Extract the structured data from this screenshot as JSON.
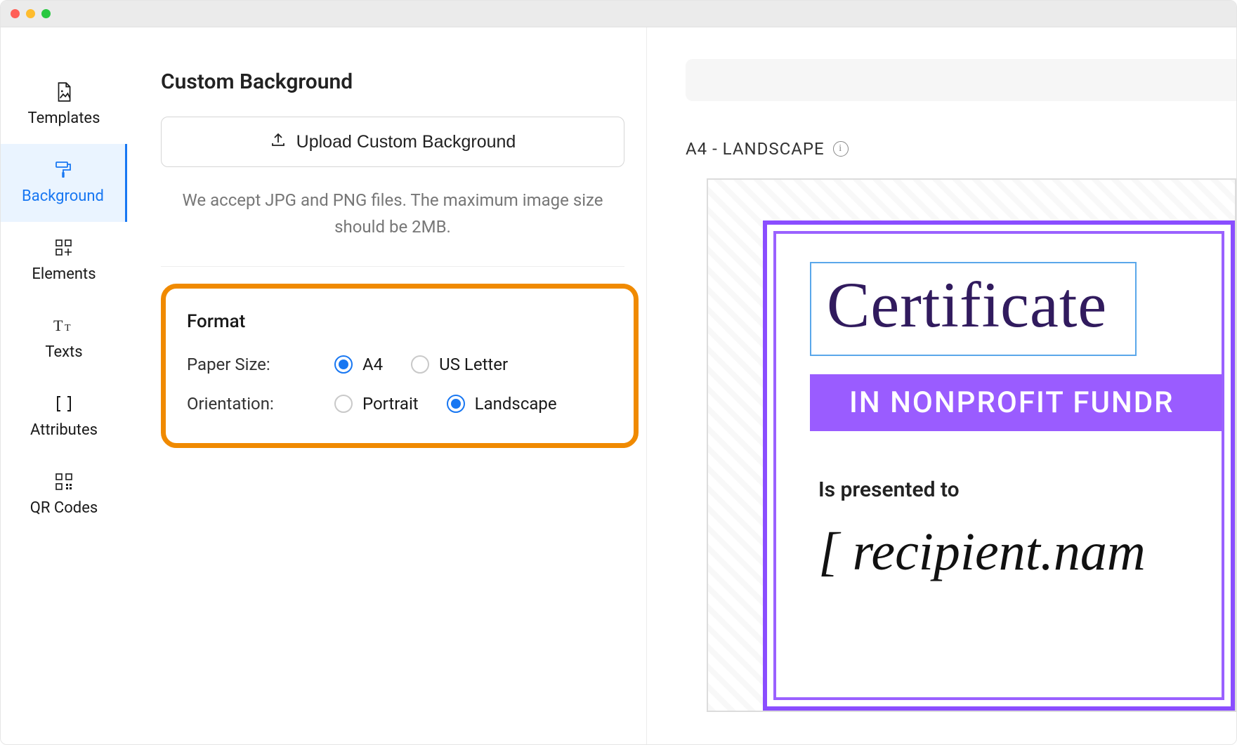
{
  "sidebar": {
    "items": [
      {
        "label": "Templates",
        "name": "sidebar-item-templates"
      },
      {
        "label": "Background",
        "name": "sidebar-item-background",
        "active": true
      },
      {
        "label": "Elements",
        "name": "sidebar-item-elements"
      },
      {
        "label": "Texts",
        "name": "sidebar-item-texts"
      },
      {
        "label": "Attributes",
        "name": "sidebar-item-attributes"
      },
      {
        "label": "QR Codes",
        "name": "sidebar-item-qrcodes"
      }
    ]
  },
  "panel": {
    "title": "Custom Background",
    "upload_label": "Upload Custom Background",
    "hint": "We accept JPG and PNG files. The maximum image size should be 2MB.",
    "format": {
      "title": "Format",
      "paper_size_label": "Paper Size:",
      "paper_size_options": {
        "a4": "A4",
        "us_letter": "US Letter"
      },
      "paper_size_selected": "a4",
      "orientation_label": "Orientation:",
      "orientation_options": {
        "portrait": "Portrait",
        "landscape": "Landscape"
      },
      "orientation_selected": "landscape"
    }
  },
  "canvas": {
    "size_label": "A4 - LANDSCAPE",
    "certificate": {
      "title": "Certificate",
      "band": "IN NONPROFIT FUNDR",
      "presented": "Is presented to",
      "recipient": "[ recipient.nam"
    }
  },
  "colors": {
    "accent_blue": "#1877f2",
    "highlight_orange": "#f08a00",
    "cert_purple": "#9a5cff",
    "cert_deep": "#311b5e"
  }
}
